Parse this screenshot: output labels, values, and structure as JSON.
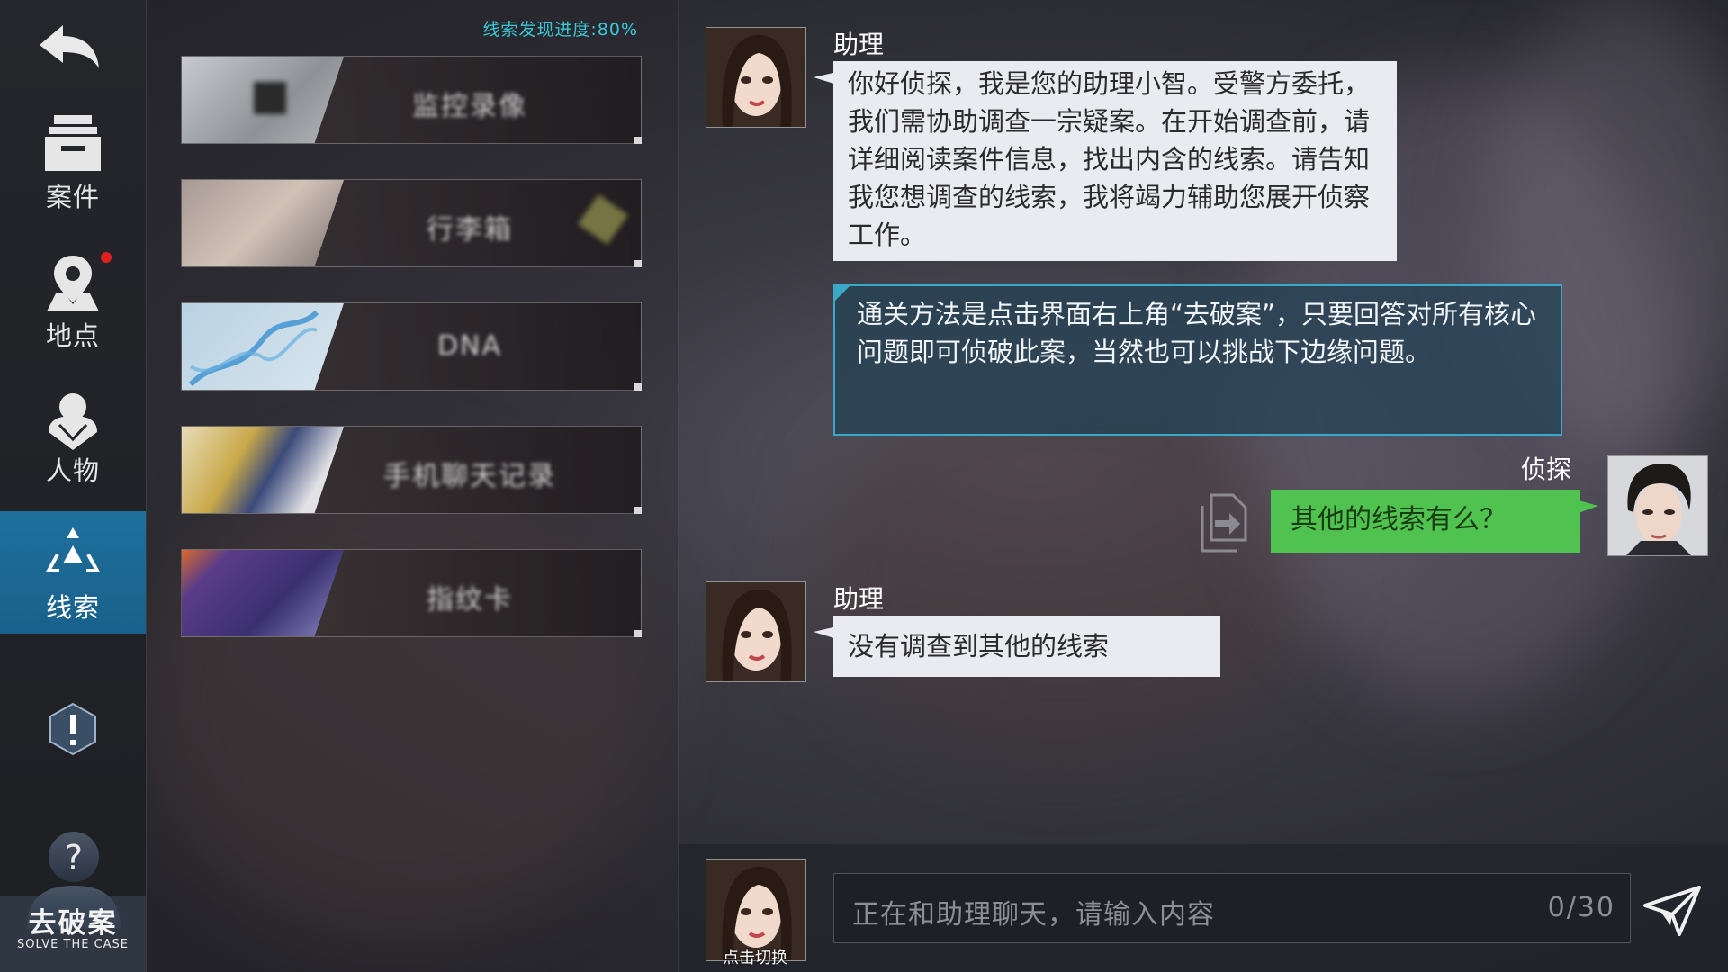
{
  "nav": {
    "items": [
      {
        "label": "案件",
        "icon": "case-box-icon"
      },
      {
        "label": "地点",
        "icon": "location-pin-icon"
      },
      {
        "label": "人物",
        "icon": "person-icon"
      },
      {
        "label": "线索",
        "icon": "clue-triangle-icon",
        "active": true
      }
    ],
    "back_icon": "back-arrow-icon",
    "alert_icon": "exclamation-shield-icon",
    "solve": {
      "label_cn": "去破案",
      "label_en": "SOLVE THE CASE",
      "icon": "question-person-icon"
    },
    "notification_color": "#e02020"
  },
  "clues": {
    "progress": "线索发现进度:80%",
    "items": [
      {
        "name": "监控录像",
        "thumb_colors": [
          "#b8bcc0",
          "#6a6e72"
        ]
      },
      {
        "name": "行李箱",
        "thumb_colors": [
          "#9a8e88",
          "#c9b8ae"
        ]
      },
      {
        "name": "DNA",
        "thumb_colors": [
          "#9fc3d8",
          "#3a8fcf"
        ]
      },
      {
        "name": "手机聊天记录",
        "thumb_colors": [
          "#c9a94a",
          "#3b4a7a"
        ]
      },
      {
        "name": "指纹卡",
        "thumb_colors": [
          "#4b3d8a",
          "#d96a2a"
        ]
      }
    ],
    "accent_color": "#39c8d6"
  },
  "chat": {
    "messages": [
      {
        "speaker": "助理",
        "text": "你好侦探，我是您的助理小智。受警方委托，我们需协助调查一宗疑案。在开始调查前，请详细阅读案件信息，找出内含的线索。请告知我您想调查的线索，我将竭力辅助您展开侦察工作。"
      },
      {
        "type": "system",
        "text": "通关方法是点击界面右上角“去破案”，只要回答对所有核心问题即可侦破此案，当然也可以挑战下边缘问题。"
      },
      {
        "speaker": "侦探",
        "text": "其他的线索有么？"
      },
      {
        "speaker": "助理",
        "text": "没有调查到其他的线索"
      }
    ],
    "colors": {
      "assistant_bubble": "#e9ebf1",
      "system_border": "#3aa9c8",
      "player_bubble": "#4fc24f"
    }
  },
  "input": {
    "placeholder": "正在和助理聊天，请输入内容",
    "count": "0/30",
    "switch_label": "点击切换",
    "send_icon": "send-paper-plane-icon"
  }
}
